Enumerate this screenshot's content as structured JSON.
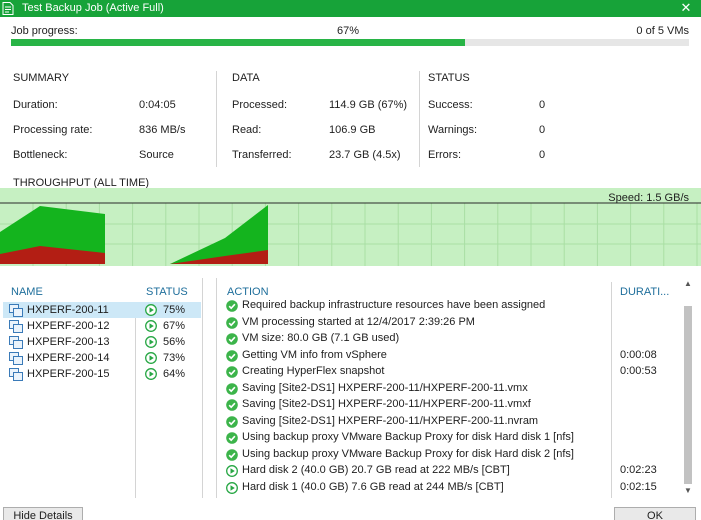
{
  "window": {
    "title": "Test Backup Job (Active Full)",
    "close_glyph": "✕"
  },
  "progress": {
    "label": "Job progress:",
    "percent_text": "67%",
    "fraction": 0.67,
    "vms_text": "0 of 5 VMs",
    "color": "#28b446"
  },
  "summary": {
    "heading": "SUMMARY",
    "rows": [
      {
        "key": "Duration:",
        "value": "0:04:05"
      },
      {
        "key": "Processing rate:",
        "value": "836 MB/s"
      },
      {
        "key": "Bottleneck:",
        "value": "Source"
      }
    ]
  },
  "data_section": {
    "heading": "DATA",
    "rows": [
      {
        "key": "Processed:",
        "value": "114.9 GB (67%)"
      },
      {
        "key": "Read:",
        "value": "106.9 GB"
      },
      {
        "key": "Transferred:",
        "value": "23.7 GB (4.5x)"
      }
    ]
  },
  "status_section": {
    "heading": "STATUS",
    "rows": [
      {
        "key": "Success:",
        "value": "0"
      },
      {
        "key": "Warnings:",
        "value": "0"
      },
      {
        "key": "Errors:",
        "value": "0"
      }
    ]
  },
  "throughput": {
    "label": "THROUGHPUT (ALL TIME)",
    "speed": "Speed: 1.5 GB/s"
  },
  "vm_list": {
    "name_header": "NAME",
    "status_header": "STATUS",
    "items": [
      {
        "name": "HXPERF-200-11",
        "percent": "75%",
        "selected": true
      },
      {
        "name": "HXPERF-200-12",
        "percent": "67%",
        "selected": false
      },
      {
        "name": "HXPERF-200-13",
        "percent": "56%",
        "selected": false
      },
      {
        "name": "HXPERF-200-14",
        "percent": "73%",
        "selected": false
      },
      {
        "name": "HXPERF-200-15",
        "percent": "64%",
        "selected": false
      }
    ]
  },
  "actions": {
    "action_header": "ACTION",
    "duration_header": "DURATI...",
    "items": [
      {
        "text": "Required backup infrastructure resources have been assigned",
        "duration": "",
        "icon": "success-check-icon"
      },
      {
        "text": "VM processing started at 12/4/2017 2:39:26 PM",
        "duration": "",
        "icon": "success-check-icon"
      },
      {
        "text": "VM size: 80.0 GB (7.1 GB used)",
        "duration": "",
        "icon": "success-check-icon"
      },
      {
        "text": "Getting VM info from vSphere",
        "duration": "0:00:08",
        "icon": "success-check-icon"
      },
      {
        "text": "Creating HyperFlex snapshot",
        "duration": "0:00:53",
        "icon": "success-check-icon"
      },
      {
        "text": "Saving [Site2-DS1] HXPERF-200-11/HXPERF-200-11.vmx",
        "duration": "",
        "icon": "success-check-icon"
      },
      {
        "text": "Saving [Site2-DS1] HXPERF-200-11/HXPERF-200-11.vmxf",
        "duration": "",
        "icon": "success-check-icon"
      },
      {
        "text": "Saving [Site2-DS1] HXPERF-200-11/HXPERF-200-11.nvram",
        "duration": "",
        "icon": "success-check-icon"
      },
      {
        "text": "Using backup proxy VMware Backup Proxy for disk Hard disk 1 [nfs]",
        "duration": "",
        "icon": "success-check-icon"
      },
      {
        "text": "Using backup proxy VMware Backup Proxy for disk Hard disk 2 [nfs]",
        "duration": "",
        "icon": "success-check-icon"
      },
      {
        "text": "Hard disk 2 (40.0 GB) 20.7 GB read at 222 MB/s [CBT]",
        "duration": "0:02:23",
        "icon": "running-play-icon"
      },
      {
        "text": "Hard disk 1 (40.0 GB) 7.6 GB read at 244 MB/s [CBT]",
        "duration": "0:02:15",
        "icon": "running-play-icon"
      }
    ]
  },
  "buttons": {
    "hide_details": "Hide Details",
    "ok": "OK"
  },
  "colors": {
    "title_bar": "#17a339",
    "chart_bg": "#c6f0c2",
    "chart_area": "#14b41e",
    "chart_bottleneck": "#b31e14",
    "selection": "#cde8f7",
    "header_text": "#1e6e9b"
  }
}
